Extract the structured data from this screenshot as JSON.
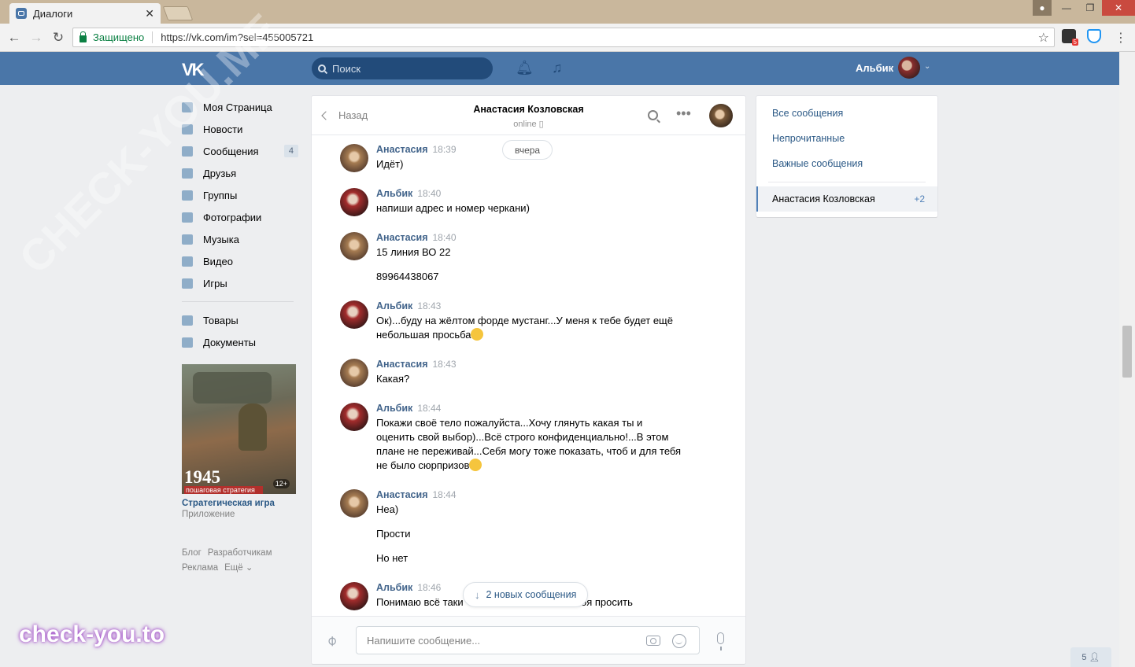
{
  "browser": {
    "tab_title": "Диалоги",
    "tab_close": "✕",
    "secure_label": "Защищено",
    "url": "https://vk.com/im?sel=455005721",
    "ext_badge": "5"
  },
  "header": {
    "logo": "VK",
    "search_placeholder": "Поиск",
    "user_name": "Альбик"
  },
  "nav": {
    "items": [
      {
        "label": "Моя Страница"
      },
      {
        "label": "Новости"
      },
      {
        "label": "Сообщения",
        "count": "4"
      },
      {
        "label": "Друзья"
      },
      {
        "label": "Группы"
      },
      {
        "label": "Фотографии"
      },
      {
        "label": "Музыка"
      },
      {
        "label": "Видео"
      },
      {
        "label": "Игры"
      },
      {
        "label": "Товары"
      },
      {
        "label": "Документы"
      }
    ]
  },
  "ad": {
    "image_year": "1945",
    "image_caption": "пошаговая стратегия",
    "image_age": "12+",
    "title": "Стратегическая игра",
    "subtitle": "Приложение"
  },
  "footer": {
    "links": [
      "Блог",
      "Разработчикам",
      "Реклама",
      "Ещё ⌄"
    ]
  },
  "chat": {
    "back_label": "Назад",
    "peer_name": "Анастасия Козловская",
    "peer_status": "online ▯",
    "day_label": "вчера",
    "messages": [
      {
        "author": "Анастасия",
        "time": "18:39",
        "text": "Идёт)"
      },
      {
        "author": "Альбик",
        "time": "18:40",
        "text": "напиши адрес и номер черкани)"
      },
      {
        "author": "Анастасия",
        "time": "18:40",
        "text": "15 линия ВО 22",
        "text2": "89964438067"
      },
      {
        "author": "Альбик",
        "time": "18:43",
        "text": "Ок)...буду на жёлтом форде мустанг...У меня к тебе будет ещё небольшая просьба"
      },
      {
        "author": "Анастасия",
        "time": "18:43",
        "text": "Какая?"
      },
      {
        "author": "Альбик",
        "time": "18:44",
        "text": "Покажи своё тело пожалуйста...Хочу глянуть какая ты и оценить свой выбор)...Всё строго конфиденциально!...В этом плане не переживай...Себя могу тоже показать, чтоб и для тебя не было сюрпризов"
      },
      {
        "author": "Анастасия",
        "time": "18:44",
        "text": "Неа)",
        "text2": "Прости",
        "text3": "Но нет"
      },
      {
        "author": "Альбик",
        "time": "18:46",
        "text": "Понимаю всё таки",
        "text_tail": "оя просить"
      }
    ],
    "new_messages_label": "2 новых сообщения",
    "composer_placeholder": "Напишите сообщение..."
  },
  "filters": {
    "items": [
      "Все сообщения",
      "Непрочитанные",
      "Важные сообщения"
    ],
    "active_name": "Анастасия Козловская",
    "active_count": "+2"
  },
  "online_count": "5",
  "watermarks": {
    "diagonal": "CHECK-YOU.ME",
    "brand": "check-you.to"
  }
}
